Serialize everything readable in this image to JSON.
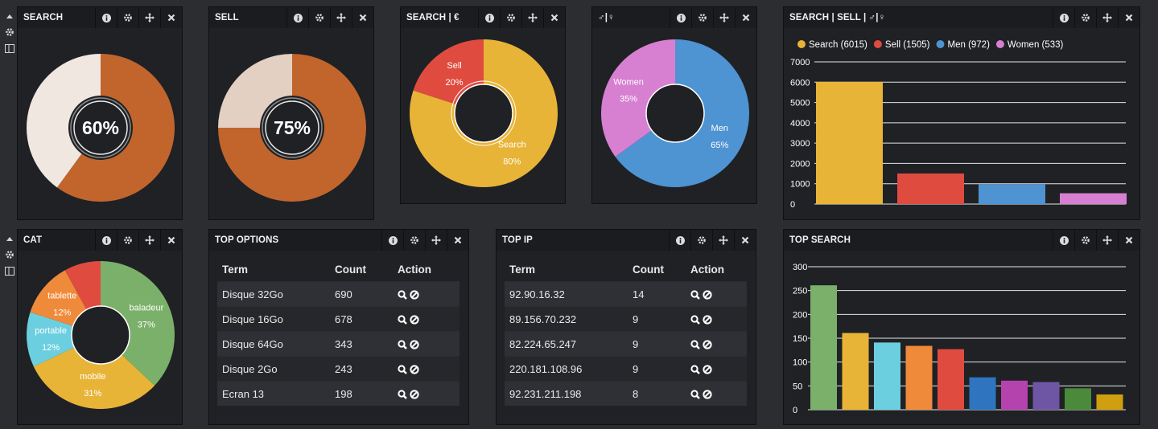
{
  "colors": {
    "panel": "#1f2125",
    "header": "#1b1c20",
    "page": "#2b2d31",
    "gold": "#e8b437",
    "red": "#e04b40",
    "blue": "#4e93d2",
    "pink": "#d77fd0",
    "orange_brown": "#c1652c",
    "light": "#f1e7e1"
  },
  "row_controls": {
    "icons": [
      "caret-up-icon",
      "gear-icon",
      "layout-icon"
    ]
  },
  "header_icons": [
    "info-icon",
    "gear-icon",
    "move-icon",
    "close-icon"
  ],
  "search_panel": {
    "title": "SEARCH",
    "center": "60%",
    "percent": 60
  },
  "sell_panel": {
    "title": "SELL",
    "center": "75%",
    "percent": 75
  },
  "search_sell_money": {
    "title": "SEARCH | €",
    "slices": [
      {
        "label": "Search",
        "pct": "80%",
        "value": 80
      },
      {
        "label": "Sell",
        "pct": "20%",
        "value": 20
      }
    ]
  },
  "gender": {
    "title": "♂|♀",
    "slices": [
      {
        "label": "Men",
        "pct": "65%",
        "value": 65
      },
      {
        "label": "Women",
        "pct": "35%",
        "value": 35
      }
    ]
  },
  "summary_chart": {
    "title": "SEARCH | SELL | ♂|♀",
    "chart_data": {
      "type": "bar",
      "categories": [
        "Search",
        "Sell",
        "Men",
        "Women"
      ],
      "series": [
        {
          "name": "Search (6015)",
          "values": [
            6015
          ]
        },
        {
          "name": "Sell (1505)",
          "values": [
            1505
          ]
        },
        {
          "name": "Men (972)",
          "values": [
            972
          ]
        },
        {
          "name": "Women (533)",
          "values": [
            533
          ]
        }
      ],
      "values": [
        6015,
        1505,
        972,
        533
      ],
      "yticks": [
        "0",
        "1000",
        "2000",
        "3000",
        "4000",
        "5000",
        "6000",
        "7000"
      ],
      "ylim": [
        0,
        7000
      ],
      "legend_position": "top",
      "grid": true
    }
  },
  "cat_panel": {
    "title": "CAT",
    "slices": [
      {
        "label": "baladeur",
        "pct": "37%",
        "value": 37
      },
      {
        "label": "mobile",
        "pct": "31%",
        "value": 31
      },
      {
        "label": "portable",
        "pct": "12%",
        "value": 12
      },
      {
        "label": "tablette",
        "pct": "12%",
        "value": 12
      },
      {
        "label": "",
        "pct": "",
        "value": 8
      }
    ]
  },
  "top_options": {
    "title": "TOP OPTIONS",
    "headers": {
      "term": "Term",
      "count": "Count",
      "action": "Action"
    },
    "rows": [
      {
        "term": "Disque 32Go",
        "count": "690"
      },
      {
        "term": "Disque 16Go",
        "count": "678"
      },
      {
        "term": "Disque 64Go",
        "count": "343"
      },
      {
        "term": "Disque 2Go",
        "count": "243"
      },
      {
        "term": "Ecran 13",
        "count": "198"
      }
    ]
  },
  "top_ip": {
    "title": "TOP IP",
    "headers": {
      "term": "Term",
      "count": "Count",
      "action": "Action"
    },
    "rows": [
      {
        "term": "92.90.16.32",
        "count": "14"
      },
      {
        "term": "89.156.70.232",
        "count": "9"
      },
      {
        "term": "82.224.65.247",
        "count": "9"
      },
      {
        "term": "220.181.108.96",
        "count": "9"
      },
      {
        "term": "92.231.211.198",
        "count": "8"
      }
    ]
  },
  "top_search": {
    "title": "TOP SEARCH",
    "chart_data": {
      "type": "bar",
      "values": [
        261,
        161,
        141,
        134,
        127,
        68,
        61,
        58,
        45,
        32
      ],
      "colors": [
        "#7bb06a",
        "#e8b437",
        "#6ccfe0",
        "#ef8a3a",
        "#e04b40",
        "#2f74bf",
        "#b543ad",
        "#6f56a5",
        "#4a8a3a",
        "#cf9f0f"
      ],
      "yticks": [
        "0",
        "50",
        "100",
        "150",
        "200",
        "250",
        "300"
      ],
      "ylim": [
        0,
        300
      ],
      "grid": true
    }
  }
}
